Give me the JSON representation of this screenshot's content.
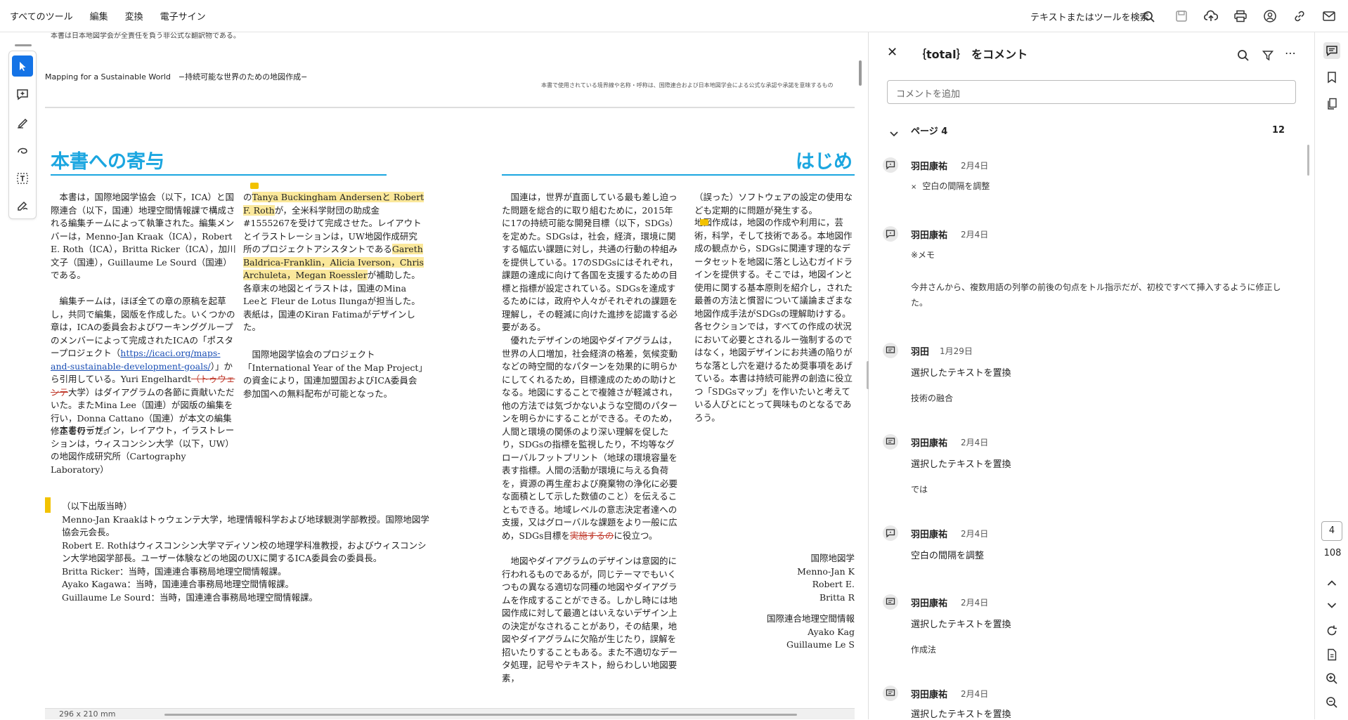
{
  "menu": {
    "items": [
      "すべてのツール",
      "編集",
      "変換",
      "電子サイン"
    ]
  },
  "search": {
    "label": "テキストまたはツールを検索"
  },
  "doc": {
    "top_note": "本書は日本地図学会が全責任を負う非公式な翻訳物である。",
    "header_left": "Mapping for a Sustainable World　−持続可能な世界のための地図作成−",
    "header_right": "本書で使用されている境界線や名称・呼称は、国際連合および日本地図学会による公式な承認や承諾を意味するもの",
    "h1": "本書への寄与",
    "h2": "はじめ",
    "col1": {
      "p1a": "本書は，国際地図学協会（以下，ICA）と国際連合（以下，国連）地理空間情報課で構成される編集チームによって執筆された。編集メンバーは，Menno-Jan Kraak（ICA），Robert E. Roth（ICA），Britta Ricker（ICA），加川文子（国連），Guillaume Le Sourd（国連）である。",
      "p2a": "編集チームは，ほぼ全ての章の原稿を起草し，共同で編集，図版を作成した。いくつかの章は，ICAの委員会およびワーキンググループのメンバーによって完成されたICAの「ポスタープロジェクト（",
      "link": "https://icaci.org/maps-and-sustainable-development-goals/",
      "p2b": "）」から引用している。Yuri Engelhardt",
      "strike1": "（トゥウェンテ",
      "p2c": "大学）はダイアグラムの各節に貢献いただいた。またMina Lee（国連）が図版の編集を行い，Donna Cattano（国連）が本文の編集修正を行った。",
      "p3": "本書のデザイン，レイアウト，イラストレーションは，ウィスコンシン大学（以下，UW）の地図作成研究所（Cartography　Laboratory）"
    },
    "col2": {
      "pre": "の",
      "hl1": "Tanya Buckingham Andersenと Robert F. Roth",
      "mid": "が，全米科学財団の助成金#1555267を受けて完成させた。レイアウトとイラストレーションは，UW地図作成研究所のプロジェクトアシスタントである",
      "hl2": "Gareth Baldrica-Franklin，Alicia Iverson，Chris Archuleta，Megan Roessler",
      "post": "が補助した。各章末の地図とイラストは，国連のMina Leeと Fleur de Lotus Ilungaが担当した。表紙は，国連のKiran Fatimaがデザインした。",
      "p2": "国際地図学協会のプロジェクト「International Year of the Map Project」の資金により，国連加盟国およびICA委員会参加国への無料配布が可能となった。"
    },
    "after": {
      "title": "（以下出版当時）",
      "l1": "Menno-Jan Kraakはトゥウェンテ大学，地理情報科学および地球観測学部教授。国際地図学協会元会長。",
      "l2": "Robert E. Rothはウィスコンシン大学マディソン校の地理学科准教授，およびウィスコンシン大学地図学部長。ユーザー体験などの地図のUXに関するICA委員会の委員長。",
      "l3": "Britta Ricker：当時，国連連合事務局地理空間情報課。",
      "l4": "Ayako Kagawa：当時，国連連合事務局地理空間情報課。",
      "l5": "Guillaume Le Sourd：当時，国連連合事務局地理空間情報課。"
    },
    "col3": {
      "p1": "国連は，世界が直面している最も差し迫った問題を総合的に取り組むために，2015年に17の持続可能な開発目標（以下，SDGs）を定めた。SDGsは，社会，経済，環境に関する幅広い課題に対し，共通の行動の枠組みを提供している。17のSDGsにはそれぞれ，課題の達成に向けて各国を支援するための目標と指標が設定されている。SDGsを達成するためには，政府や人々がそれぞれの課題を理解し，その軽減に向けた進捗を認識する必要がある。",
      "p2": "優れたデザインの地図やダイアグラムは，世界の人口増加，社会経済の格差，気候変動などの時空間的なパターンを効果的に明らかにしてくれるため，目標達成のための助けとなる。地図にすることで複雑さが軽減され，他の方法では気づかないような空間のパターンを明らかにすることができる。そのため，人間と環境の関係のより深い理解を促したり，SDGsの指標を監視したり，不均等なグローバルフットプリント（地球の環境容量を表す指標。人間の活動が環境に与える負荷を，資源の再生産および廃棄物の浄化に必要な面積として示した数値のこと）を伝えることもできる。地域レベルの意志決定者達への支援，又はグローバルな課題をより一般に広め，SDGs目標を",
      "strike": "実施するの",
      "p2end": "に役立つ。",
      "p3": "地図やダイアグラムのデザインは意図的に行われるものであるが，同じテーマでもいくつもの異なる適切な同種の地図やダイアグラムを作成することができる。しかし時には地図作成に対して最適とはいえないデザイン上の決定がなされることがあり，その結果，地図やダイアグラムに欠陥が生じたり，誤解を招いたりすることもある。また不適切なデータ処理，記号やテキスト，紛らわしい地図要素，"
    },
    "col4": {
      "p1": "（誤った）ソフトウェアの設定の使用なども定期的に問題が発生する。",
      "p2": "地図作成は，地図の作成や利用に，芸術，科学，そして技術である。本地図作成の観点から，SDGsに関連す理的なデータセットを地図に落とし込むガイドラインを提供する。そこでは，地図インと使用に関する基本原則を紹介し，された最善の方法と慣習について議論まざまな地図作成手法がSDGsの理解助けする。各セクションでは，すべての作成の状況において必要とされるルー強制するのではなく，地図デザインにお共通の陥りがちな落とし穴を避けるため奨事項をあげている。本書は持続可能界の創造に役立つ「SDGsマップ」を作いたいと考えている人びとにとって興味ものとなるであろう。",
      "c1": "国際地図学",
      "c2": "Menno-Jan K",
      "c3": "Robert E.",
      "c4": "Britta R",
      "c5": "国際連合地理空間情報",
      "c6": "Ayako Kag",
      "c7": "Guillaume Le S"
    },
    "page_size": "296 x 210 mm"
  },
  "panel": {
    "title": "｛total｝ をコメント",
    "add_placeholder": "コメントを追加",
    "page_label": "ページ 4",
    "page_count": "12",
    "comments": [
      {
        "author": "羽田康祐",
        "date": "2月4日",
        "text": "空白の間隔を調整"
      },
      {
        "author": "羽田康祐",
        "date": "2月4日",
        "text": "※メモ",
        "body": "今井さんから、複数用語の列挙の前後の句点をトル指示だが、初校ですべて挿入するように修正した。"
      },
      {
        "author": "羽田",
        "date": "1月29日",
        "text": "選択したテキストを置換",
        "body": "技術の融合"
      },
      {
        "author": "羽田康祐",
        "date": "2月4日",
        "text": "選択したテキストを置換",
        "body": "では"
      },
      {
        "author": "羽田康祐",
        "date": "2月4日",
        "text": "空白の間隔を調整"
      },
      {
        "author": "羽田康祐",
        "date": "2月4日",
        "text": "選択したテキストを置換",
        "body": "作成法"
      },
      {
        "author": "羽田康祐",
        "date": "2月4日",
        "text": "選択したテキストを置換"
      }
    ]
  },
  "rightrail": {
    "current_page": "4",
    "total_pages": "108"
  }
}
